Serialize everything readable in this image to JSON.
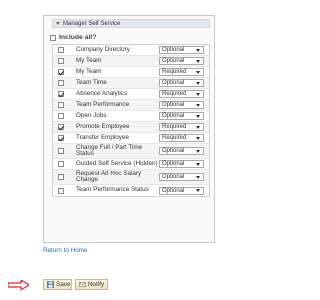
{
  "panel": {
    "title": "Manager Self Service",
    "include_all_label": "Include all?",
    "include_all_checked": false
  },
  "items": [
    {
      "label": "Company Directory",
      "checked": false,
      "value": "Optional"
    },
    {
      "label": "My Team",
      "checked": false,
      "value": "Optional"
    },
    {
      "label": "My Team",
      "checked": true,
      "value": "Required"
    },
    {
      "label": "Team Time",
      "checked": false,
      "value": "Optional"
    },
    {
      "label": "Absence Analytics",
      "checked": true,
      "value": "Required"
    },
    {
      "label": "Team Performance",
      "checked": false,
      "value": "Optional"
    },
    {
      "label": "Open Jobs",
      "checked": false,
      "value": "Optional"
    },
    {
      "label": "Promote Employee",
      "checked": true,
      "value": "Required"
    },
    {
      "label": "Transfer Employee",
      "checked": true,
      "value": "Required"
    },
    {
      "label": "Change Full / Part Time Status",
      "checked": false,
      "value": "Optional"
    },
    {
      "label": "Guided Self Service (Hidden)",
      "checked": false,
      "value": "Optional"
    },
    {
      "label": "Request Ad Hoc Salary Change",
      "checked": false,
      "value": "Optional"
    },
    {
      "label": "Team Performance Status",
      "checked": false,
      "value": "Optional"
    }
  ],
  "links": {
    "return_home": "Return to Home"
  },
  "buttons": {
    "save": "Save",
    "notify": "Notify"
  },
  "colors": {
    "link": "#2a66b8",
    "arrow": "#e0242a",
    "button_bg": "#f5ead4"
  }
}
